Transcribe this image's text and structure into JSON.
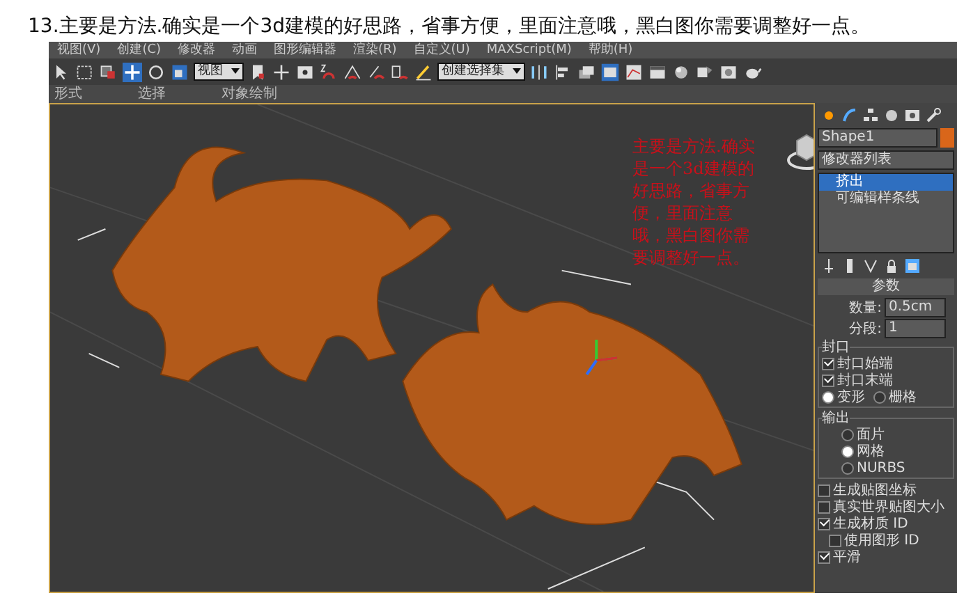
{
  "caption": "13.主要是方法.确实是一个3d建模的好思路，省事方便，里面注意哦，黑白图你需要调整好一点。",
  "menu": [
    "视图(V)",
    "创建(C)",
    "修改器",
    "动画",
    "图形编辑器",
    "渲染(R)",
    "自定义(U)",
    "MAXScript(M)",
    "帮助(H)"
  ],
  "toolbar": {
    "view_dropdown": "视图",
    "selection_set_dropdown": "创建选择集"
  },
  "ribbon_tabs": [
    "形式",
    "选择",
    "对象绘制"
  ],
  "viewport": {
    "annotation": "主要是方法.确实是一个3d建模的好思路，省事方便，里面注意哦，黑白图你需要调整好一点。"
  },
  "command_panel": {
    "object_name": "Shape1",
    "modifier_list": "修改器列表",
    "stack": [
      {
        "label": "挤出",
        "selected": true
      },
      {
        "label": "可编辑样条线",
        "selected": false
      }
    ],
    "rollout_title": "参数",
    "fields": [
      {
        "label": "数量:",
        "value": "0.5cm"
      },
      {
        "label": "分段:",
        "value": "1"
      }
    ],
    "cap_group": {
      "title": "封口",
      "checks": [
        {
          "label": "封口始端",
          "checked": true
        },
        {
          "label": "封口末端",
          "checked": true
        }
      ],
      "radios": [
        {
          "label": "变形",
          "selected": true
        },
        {
          "label": "栅格",
          "selected": false
        }
      ]
    },
    "output_group": {
      "title": "输出",
      "radios": [
        {
          "label": "面片",
          "selected": false
        },
        {
          "label": "网格",
          "selected": true
        },
        {
          "label": "NURBS",
          "selected": false
        }
      ]
    },
    "options": [
      {
        "label": "生成贴图坐标",
        "checked": false
      },
      {
        "label": "真实世界贴图大小",
        "checked": false
      },
      {
        "label": "生成材质 ID",
        "checked": true,
        "children": [
          {
            "label": "使用图形 ID",
            "checked": false
          }
        ]
      },
      {
        "label": "平滑",
        "checked": true
      }
    ]
  }
}
